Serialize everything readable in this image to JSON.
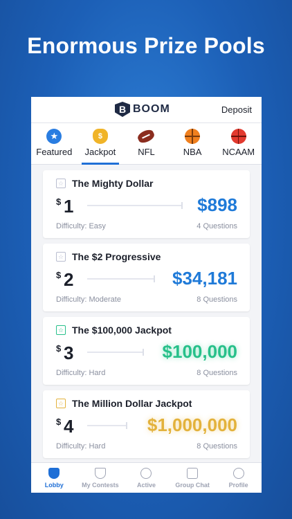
{
  "headline": "Enormous Prize Pools",
  "app": {
    "logo_letter": "B",
    "logo_text": "BOOM",
    "deposit_label": "Deposit"
  },
  "tabs": [
    {
      "label": "Featured",
      "icon": "star-icon"
    },
    {
      "label": "Jackpot",
      "icon": "money-bag-icon",
      "active": true
    },
    {
      "label": "NFL",
      "icon": "football-icon"
    },
    {
      "label": "NBA",
      "icon": "basketball-icon"
    },
    {
      "label": "NCAAM",
      "icon": "basketball-icon"
    }
  ],
  "contests": [
    {
      "title": "The Mighty Dollar",
      "entry_currency": "$",
      "entry": "1",
      "prize": "$898",
      "difficulty": "Difficulty: Easy",
      "questions": "4 Questions",
      "prize_color": "#1f7ad8"
    },
    {
      "title": "The $2 Progressive",
      "entry_currency": "$",
      "entry": "2",
      "prize": "$34,181",
      "difficulty": "Difficulty: Moderate",
      "questions": "8 Questions",
      "prize_color": "#1f7ad8"
    },
    {
      "title": "The $100,000 Jackpot",
      "entry_currency": "$",
      "entry": "3",
      "prize": "$100,000",
      "difficulty": "Difficulty: Hard",
      "questions": "8 Questions",
      "prize_color": "#27c08a"
    },
    {
      "title": "The Million Dollar Jackpot",
      "entry_currency": "$",
      "entry": "4",
      "prize": "$1,000,000",
      "difficulty": "Difficulty: Hard",
      "questions": "8 Questions",
      "prize_color": "#e3b23c"
    }
  ],
  "bottom_nav": [
    {
      "label": "Lobby",
      "icon": "shield-icon",
      "active": true
    },
    {
      "label": "My Contests",
      "icon": "trophy-icon"
    },
    {
      "label": "Active",
      "icon": "target-icon"
    },
    {
      "label": "Group Chat",
      "icon": "chat-icon"
    },
    {
      "label": "Profile",
      "icon": "person-icon"
    }
  ],
  "colors": {
    "background": "#1c5fb6",
    "accent": "#1f6fd6",
    "blue_prize": "#1f7ad8",
    "green_prize": "#27c08a",
    "gold_prize": "#e3b23c"
  }
}
